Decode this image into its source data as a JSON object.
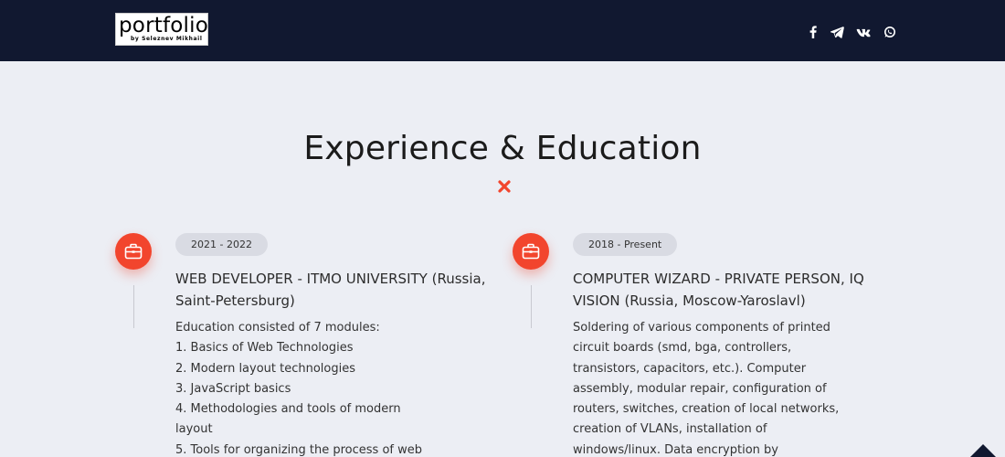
{
  "header": {
    "logo_text": "portfolio",
    "logo_subtitle": "by Seleznev Mikhail",
    "social": [
      {
        "icon": "facebook-icon"
      },
      {
        "icon": "telegram-icon"
      },
      {
        "icon": "vk-icon"
      },
      {
        "icon": "whatsapp-icon"
      }
    ]
  },
  "section": {
    "title": "Experience & Education",
    "divider_icon": "x-icon",
    "accent_color": "#f2452d"
  },
  "items": [
    {
      "icon": "briefcase-icon",
      "date": "2021 - 2022",
      "title_upper": "WEB DEVELOPER - ITMO UNIVERSITY",
      "title_rest": " (Russia, Saint-Petersburg)",
      "lines": [
        "Education consisted of 7 modules:",
        "1. Basics of Web Technologies",
        "2. Modern layout technologies",
        "3. JavaScript basics",
        "4. Methodologies and tools of modern",
        "layout",
        "5. Tools for organizing the process of web"
      ]
    },
    {
      "icon": "briefcase-icon",
      "date": "2018 - Present",
      "title_upper": "COMPUTER WIZARD - PRIVATE PERSON, IQ VISION",
      "title_rest": " (Russia, Moscow-Yaroslavl)",
      "lines": [
        "Soldering of various components of printed",
        "circuit boards (smd, bga, controllers,",
        "transistors, capacitors, etc.). Computer",
        "assembly, modular repair, configuration of",
        "routers, switches, creation of local networks,",
        "creation of VLANs, installation of",
        "windows/linux. Data encryption by"
      ]
    }
  ],
  "scroll_top_icon": "arrow-up-icon"
}
